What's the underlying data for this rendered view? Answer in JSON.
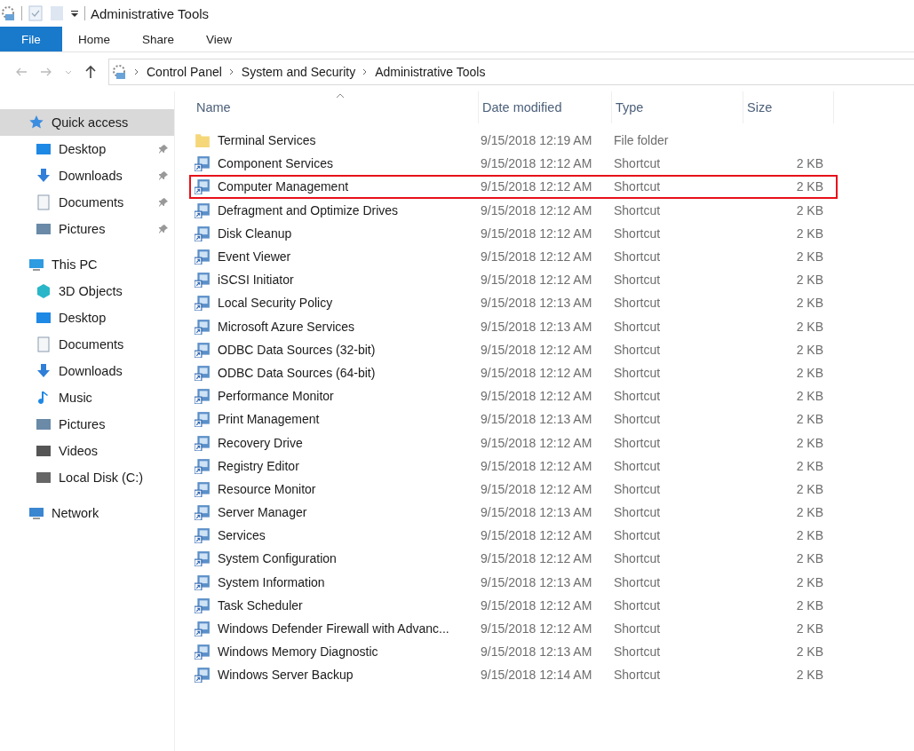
{
  "window": {
    "title": "Administrative Tools"
  },
  "tabs": [
    {
      "label": "File",
      "selected": true
    },
    {
      "label": "Home",
      "selected": false
    },
    {
      "label": "Share",
      "selected": false
    },
    {
      "label": "View",
      "selected": false
    }
  ],
  "breadcrumb": [
    "Control Panel",
    "System and Security",
    "Administrative Tools"
  ],
  "sidebar": {
    "items": [
      {
        "label": "Quick access",
        "kind": "star",
        "selected": true,
        "children": [
          {
            "label": "Desktop",
            "kind": "desktop",
            "pinned": true,
            "selected": false
          },
          {
            "label": "Downloads",
            "kind": "download",
            "pinned": true,
            "selected": false
          },
          {
            "label": "Documents",
            "kind": "document",
            "pinned": true,
            "selected": false
          },
          {
            "label": "Pictures",
            "kind": "picture",
            "pinned": true,
            "selected": false
          }
        ]
      },
      {
        "label": "This PC",
        "kind": "pc",
        "selected": false,
        "children": [
          {
            "label": "3D Objects",
            "kind": "cube",
            "pinned": false,
            "selected": false
          },
          {
            "label": "Desktop",
            "kind": "desktop",
            "pinned": false,
            "selected": false
          },
          {
            "label": "Documents",
            "kind": "document",
            "pinned": false,
            "selected": false
          },
          {
            "label": "Downloads",
            "kind": "download",
            "pinned": false,
            "selected": false
          },
          {
            "label": "Music",
            "kind": "music",
            "pinned": false,
            "selected": false
          },
          {
            "label": "Pictures",
            "kind": "picture",
            "pinned": false,
            "selected": false
          },
          {
            "label": "Videos",
            "kind": "video",
            "pinned": false,
            "selected": false
          },
          {
            "label": "Local Disk (C:)",
            "kind": "disk",
            "pinned": false,
            "selected": false
          }
        ]
      },
      {
        "label": "Network",
        "kind": "network",
        "selected": false
      }
    ]
  },
  "table": {
    "columns": [
      {
        "label": "Name",
        "sorted": true
      },
      {
        "label": "Date modified",
        "sorted": false
      },
      {
        "label": "Type",
        "sorted": false
      },
      {
        "label": "Size",
        "sorted": false
      }
    ],
    "rows": [
      {
        "kind": "folder",
        "name": "Terminal Services",
        "date": "9/15/2018 12:19 AM",
        "type": "File folder",
        "size": "",
        "highlighted": false
      },
      {
        "kind": "shortcut",
        "name": "Component Services",
        "date": "9/15/2018 12:12 AM",
        "type": "Shortcut",
        "size": "2 KB",
        "highlighted": false
      },
      {
        "kind": "shortcut",
        "name": "Computer Management",
        "date": "9/15/2018 12:12 AM",
        "type": "Shortcut",
        "size": "2 KB",
        "highlighted": true
      },
      {
        "kind": "shortcut",
        "name": "Defragment and Optimize Drives",
        "date": "9/15/2018 12:12 AM",
        "type": "Shortcut",
        "size": "2 KB",
        "highlighted": false
      },
      {
        "kind": "shortcut",
        "name": "Disk Cleanup",
        "date": "9/15/2018 12:12 AM",
        "type": "Shortcut",
        "size": "2 KB",
        "highlighted": false
      },
      {
        "kind": "shortcut",
        "name": "Event Viewer",
        "date": "9/15/2018 12:12 AM",
        "type": "Shortcut",
        "size": "2 KB",
        "highlighted": false
      },
      {
        "kind": "shortcut",
        "name": "iSCSI Initiator",
        "date": "9/15/2018 12:12 AM",
        "type": "Shortcut",
        "size": "2 KB",
        "highlighted": false
      },
      {
        "kind": "shortcut",
        "name": "Local Security Policy",
        "date": "9/15/2018 12:13 AM",
        "type": "Shortcut",
        "size": "2 KB",
        "highlighted": false
      },
      {
        "kind": "shortcut",
        "name": "Microsoft Azure Services",
        "date": "9/15/2018 12:13 AM",
        "type": "Shortcut",
        "size": "2 KB",
        "highlighted": false
      },
      {
        "kind": "shortcut",
        "name": "ODBC Data Sources (32-bit)",
        "date": "9/15/2018 12:12 AM",
        "type": "Shortcut",
        "size": "2 KB",
        "highlighted": false
      },
      {
        "kind": "shortcut",
        "name": "ODBC Data Sources (64-bit)",
        "date": "9/15/2018 12:12 AM",
        "type": "Shortcut",
        "size": "2 KB",
        "highlighted": false
      },
      {
        "kind": "shortcut",
        "name": "Performance Monitor",
        "date": "9/15/2018 12:12 AM",
        "type": "Shortcut",
        "size": "2 KB",
        "highlighted": false
      },
      {
        "kind": "shortcut",
        "name": "Print Management",
        "date": "9/15/2018 12:13 AM",
        "type": "Shortcut",
        "size": "2 KB",
        "highlighted": false
      },
      {
        "kind": "shortcut",
        "name": "Recovery Drive",
        "date": "9/15/2018 12:12 AM",
        "type": "Shortcut",
        "size": "2 KB",
        "highlighted": false
      },
      {
        "kind": "shortcut",
        "name": "Registry Editor",
        "date": "9/15/2018 12:12 AM",
        "type": "Shortcut",
        "size": "2 KB",
        "highlighted": false
      },
      {
        "kind": "shortcut",
        "name": "Resource Monitor",
        "date": "9/15/2018 12:12 AM",
        "type": "Shortcut",
        "size": "2 KB",
        "highlighted": false
      },
      {
        "kind": "shortcut",
        "name": "Server Manager",
        "date": "9/15/2018 12:13 AM",
        "type": "Shortcut",
        "size": "2 KB",
        "highlighted": false
      },
      {
        "kind": "shortcut",
        "name": "Services",
        "date": "9/15/2018 12:12 AM",
        "type": "Shortcut",
        "size": "2 KB",
        "highlighted": false
      },
      {
        "kind": "shortcut",
        "name": "System Configuration",
        "date": "9/15/2018 12:12 AM",
        "type": "Shortcut",
        "size": "2 KB",
        "highlighted": false
      },
      {
        "kind": "shortcut",
        "name": "System Information",
        "date": "9/15/2018 12:13 AM",
        "type": "Shortcut",
        "size": "2 KB",
        "highlighted": false
      },
      {
        "kind": "shortcut",
        "name": "Task Scheduler",
        "date": "9/15/2018 12:12 AM",
        "type": "Shortcut",
        "size": "2 KB",
        "highlighted": false
      },
      {
        "kind": "shortcut",
        "name": "Windows Defender Firewall with Advanc...",
        "date": "9/15/2018 12:12 AM",
        "type": "Shortcut",
        "size": "2 KB",
        "highlighted": false
      },
      {
        "kind": "shortcut",
        "name": "Windows Memory Diagnostic",
        "date": "9/15/2018 12:13 AM",
        "type": "Shortcut",
        "size": "2 KB",
        "highlighted": false
      },
      {
        "kind": "shortcut",
        "name": "Windows Server Backup",
        "date": "9/15/2018 12:14 AM",
        "type": "Shortcut",
        "size": "2 KB",
        "highlighted": false
      }
    ]
  }
}
